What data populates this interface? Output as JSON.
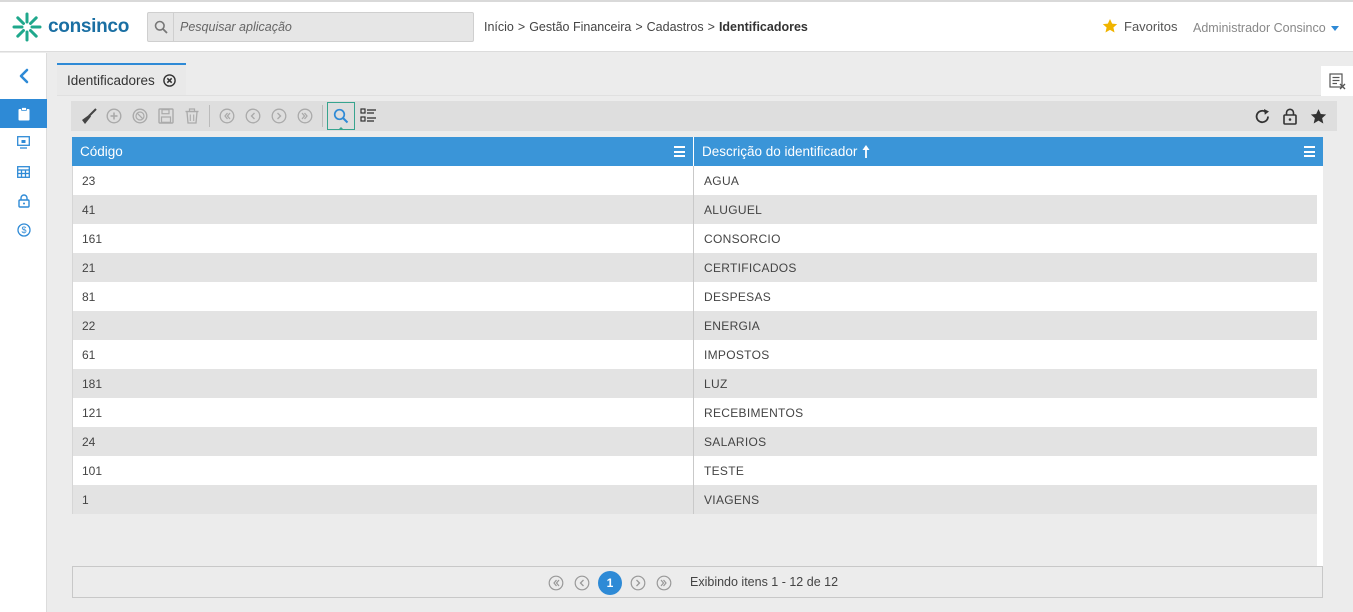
{
  "app": {
    "brand": "consinco"
  },
  "search": {
    "placeholder": "Pesquisar aplicação"
  },
  "breadcrumb": {
    "items": [
      "Início",
      "Gestão Financeira",
      "Cadastros"
    ],
    "separator": ">",
    "current": "Identificadores"
  },
  "header": {
    "favorites_label": "Favoritos",
    "user_name": "Administrador Consinco"
  },
  "tab": {
    "label": "Identificadores"
  },
  "grid": {
    "columns": [
      "Código",
      "Descrição do identificador"
    ],
    "sort": {
      "column": "Descrição do identificador",
      "direction": "asc"
    },
    "rows": [
      {
        "codigo": "23",
        "descricao": "AGUA"
      },
      {
        "codigo": "41",
        "descricao": "ALUGUEL"
      },
      {
        "codigo": "161",
        "descricao": "CONSORCIO"
      },
      {
        "codigo": "21",
        "descricao": "CERTIFICADOS"
      },
      {
        "codigo": "81",
        "descricao": "DESPESAS"
      },
      {
        "codigo": "22",
        "descricao": "ENERGIA"
      },
      {
        "codigo": "61",
        "descricao": "IMPOSTOS"
      },
      {
        "codigo": "181",
        "descricao": "LUZ"
      },
      {
        "codigo": "121",
        "descricao": "RECEBIMENTOS"
      },
      {
        "codigo": "24",
        "descricao": "SALARIOS"
      },
      {
        "codigo": "101",
        "descricao": "TESTE"
      },
      {
        "codigo": "1",
        "descricao": "VIAGENS"
      }
    ]
  },
  "pager": {
    "current_page": "1",
    "info": "Exibindo itens 1 - 12 de 12"
  },
  "colors": {
    "accent": "#2e8ad6",
    "grid_header": "#3a95d8",
    "star": "#f0b400",
    "logo_teal": "#1fa88c"
  },
  "icons": {
    "sidebar": [
      "chevron-left-icon",
      "clipboard-icon",
      "monitor-icon",
      "table-icon",
      "lock-icon",
      "dollar-icon"
    ],
    "toolbar": [
      "broom-icon",
      "add-icon",
      "cancel-icon",
      "save-icon",
      "trash-icon",
      "first-icon",
      "prev-icon",
      "next-icon",
      "last-icon",
      "search-icon",
      "list-icon",
      "refresh-icon",
      "lock-icon",
      "star-icon"
    ]
  }
}
